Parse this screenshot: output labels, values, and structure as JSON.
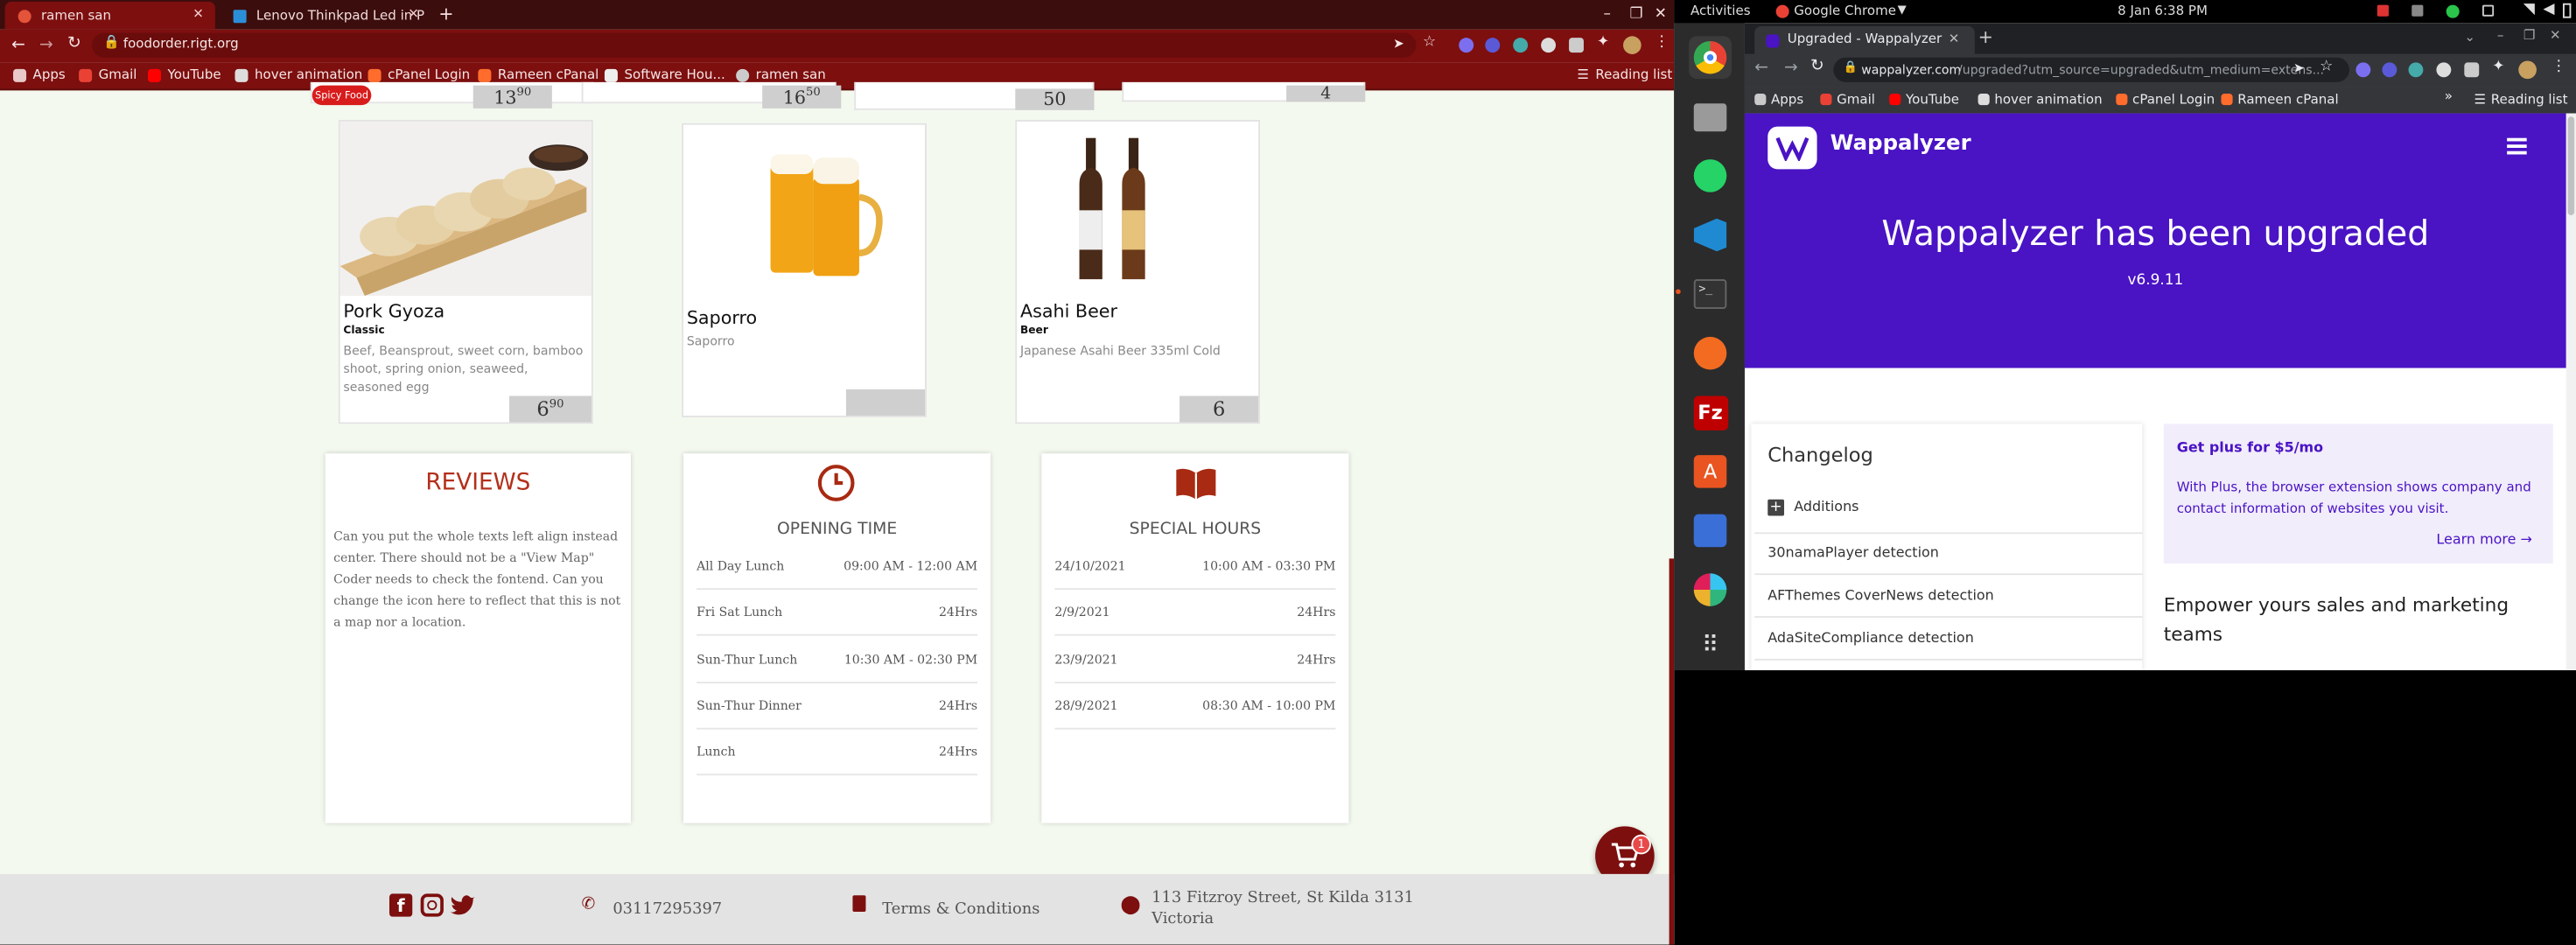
{
  "left_browser": {
    "tabs": [
      {
        "title": "ramen san",
        "active": true
      },
      {
        "title": "Lenovo Thinkpad Led in P",
        "active": false
      }
    ],
    "url": "foodorder.rigt.org",
    "bookmarks": [
      "Apps",
      "Gmail",
      "YouTube",
      "hover animation",
      "cPanel Login",
      "Rameen cPanal",
      "Software Hou...",
      "ramen san"
    ],
    "reading_list": "Reading list",
    "accent": "#7d0f0f"
  },
  "menu": {
    "top_prices": [
      {
        "badge": "Spicy Food",
        "int": "13",
        "dec": "90"
      },
      {
        "int": "16",
        "dec": "50"
      },
      {
        "int": "50",
        "dec": ""
      },
      {
        "int": "4",
        "dec": ""
      }
    ],
    "items": [
      {
        "name": "Pork Gyoza",
        "category": "Classic",
        "description": "Beef, Beansprout, sweet corn, bamboo shoot, spring onion, seaweed, seasoned egg",
        "price_int": "6",
        "price_dec": "90"
      },
      {
        "name": "Saporro",
        "category": "",
        "description": "Saporro",
        "price_int": "",
        "price_dec": ""
      },
      {
        "name": "Asahi Beer",
        "category": "Beer",
        "description": "Japanese Asahi Beer 335ml Cold",
        "price_int": "6",
        "price_dec": ""
      }
    ]
  },
  "reviews": {
    "title": "REVIEWS",
    "text": "Can you put the whole texts left align instead center. There should not be a \"View Map\" Coder needs to check the fontend. Can you change the icon here to reflect that this is not a map nor a location."
  },
  "opening": {
    "title": "OPENING TIME",
    "rows": [
      {
        "label": "All Day Lunch",
        "value": "09:00 AM - 12:00 AM"
      },
      {
        "label": "Fri Sat Lunch",
        "value": "24Hrs"
      },
      {
        "label": "Sun-Thur Lunch",
        "value": "10:30 AM - 02:30 PM"
      },
      {
        "label": "Sun-Thur Dinner",
        "value": "24Hrs"
      },
      {
        "label": "Lunch",
        "value": "24Hrs"
      }
    ]
  },
  "special": {
    "title": "SPECIAL HOURS",
    "rows": [
      {
        "label": "24/10/2021",
        "value": "10:00 AM - 03:30 PM"
      },
      {
        "label": "2/9/2021",
        "value": "24Hrs"
      },
      {
        "label": "23/9/2021",
        "value": "24Hrs"
      },
      {
        "label": "28/9/2021",
        "value": "08:30 AM - 10:00 PM"
      }
    ]
  },
  "cart": {
    "count": "1"
  },
  "footer": {
    "phone": "03117295397",
    "terms": "Terms & Conditions",
    "address_line1": "113 Fitzroy Street, St Kilda 3131",
    "address_line2": "Victoria"
  },
  "system": {
    "activities": "Activities",
    "app": "Google Chrome",
    "datetime": "8 Jan  6:38 PM"
  },
  "right_browser": {
    "tab_title": "Upgraded - Wappalyzer",
    "url_host": "wappalyzer.com",
    "url_rest": "/upgraded?utm_source=upgraded&utm_medium=extens...",
    "bookmarks": [
      "Apps",
      "Gmail",
      "YouTube",
      "hover animation",
      "cPanel Login",
      "Rameen cPanal"
    ],
    "reading_list": "Reading list"
  },
  "wappalyzer": {
    "brand": "Wappalyzer",
    "headline": "Wappalyzer has been upgraded",
    "version": "v6.9.11",
    "changelog_title": "Changelog",
    "additions_label": "Additions",
    "changelog_items": [
      "30namaPlayer detection",
      "AFThemes CoverNews detection",
      "AdaSiteCompliance detection"
    ],
    "plus_title": "Get plus for $5/mo",
    "plus_text": "With Plus, the browser extension shows company and contact information of websites you visit.",
    "learn_more": "Learn more",
    "empower": "Empower yours sales and marketing teams",
    "hero_color": "#4a13c4"
  }
}
